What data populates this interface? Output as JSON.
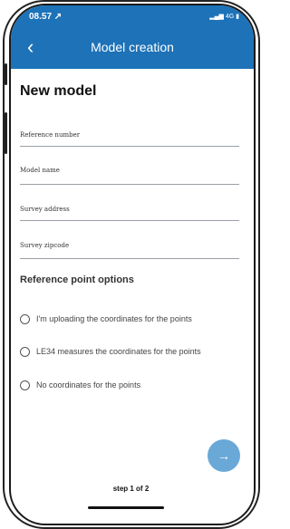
{
  "status": {
    "time": "08.57 ↗",
    "signal": "▂▄▆ 4G ▮"
  },
  "header": {
    "back_icon": "chevron-left-icon",
    "title": "Model creation"
  },
  "main": {
    "heading": "New model",
    "fields": {
      "reference_number": "Reference number",
      "model_name": "Model name",
      "survey_address": "Survey address",
      "survey_zipcode": "Survey zipcode"
    },
    "section_title": "Reference point options",
    "options": [
      "I'm uploading the coordinates for the points",
      "LE34 measures the coordinates for the points",
      "No coordinates for the points"
    ]
  },
  "footer": {
    "step": "step 1 of 2",
    "next_icon": "arrow-right-icon"
  },
  "colors": {
    "header": "#1d72b8",
    "fab": "#6aa8d8"
  }
}
